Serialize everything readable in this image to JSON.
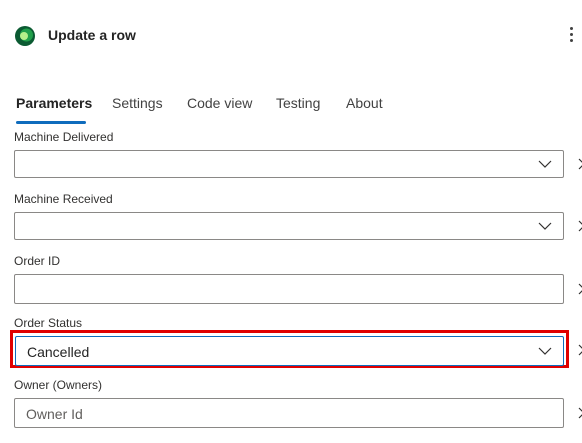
{
  "header": {
    "title": "Update a row",
    "icon": "dataverse-icon",
    "more_icon": "more-vertical-icon"
  },
  "tabs": [
    {
      "label": "Parameters",
      "active": true
    },
    {
      "label": "Settings",
      "active": false
    },
    {
      "label": "Code view",
      "active": false
    },
    {
      "label": "Testing",
      "active": false
    },
    {
      "label": "About",
      "active": false
    }
  ],
  "fields": {
    "machine_delivered": {
      "label": "Machine Delivered",
      "value": "",
      "type": "dropdown"
    },
    "machine_received": {
      "label": "Machine Received",
      "value": "",
      "type": "dropdown"
    },
    "order_id": {
      "label": "Order ID",
      "value": "",
      "type": "text"
    },
    "order_status": {
      "label": "Order Status",
      "value": "Cancelled",
      "type": "dropdown"
    },
    "owner": {
      "label": "Owner (Owners)",
      "placeholder": "Owner Id",
      "type": "text"
    }
  },
  "colors": {
    "accent": "#0f6cbd",
    "highlight": "#e00000",
    "icon_green_dark": "#0b5a32",
    "icon_green_light": "#4ec24a"
  }
}
